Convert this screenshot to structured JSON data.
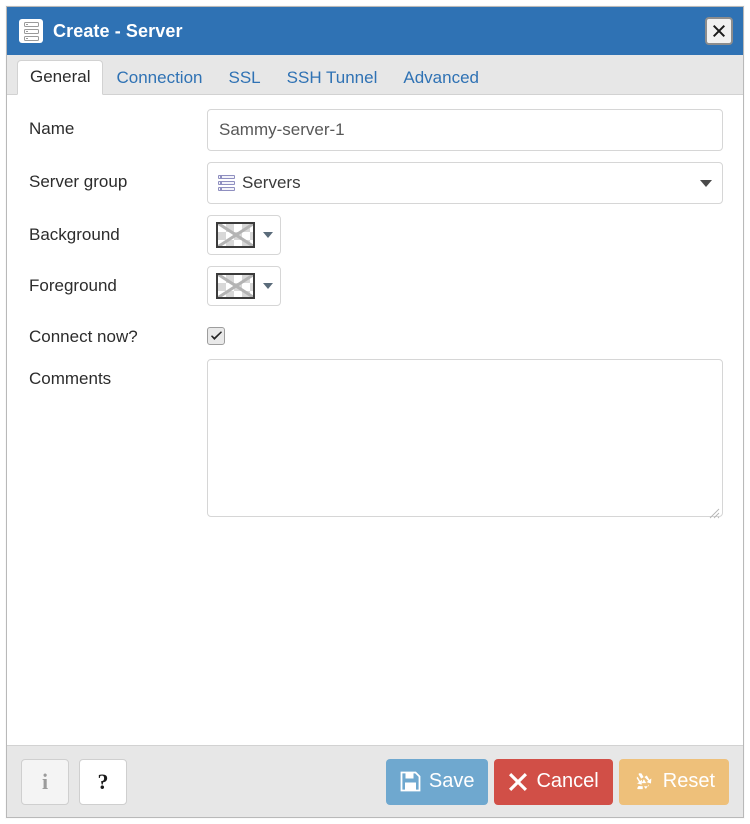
{
  "window": {
    "title": "Create - Server",
    "title_icon": "server-icon",
    "close_icon": "close-icon",
    "titlebar_color": "#2f72b4"
  },
  "tabs": [
    {
      "label": "General",
      "active": true
    },
    {
      "label": "Connection",
      "active": false
    },
    {
      "label": "SSL",
      "active": false
    },
    {
      "label": "SSH Tunnel",
      "active": false
    },
    {
      "label": "Advanced",
      "active": false
    }
  ],
  "form": {
    "name": {
      "label": "Name",
      "value": "Sammy-server-1",
      "placeholder": "Name"
    },
    "server_group": {
      "label": "Server group",
      "value": "Servers",
      "icon": "server-group-icon",
      "caret_icon": "chevron-down-icon"
    },
    "background": {
      "label": "Background",
      "value": "",
      "swatch": "transparent-none",
      "caret_icon": "chevron-down-icon"
    },
    "foreground": {
      "label": "Foreground",
      "value": "",
      "swatch": "transparent-none",
      "caret_icon": "chevron-down-icon"
    },
    "connect_now": {
      "label": "Connect now?",
      "checked": true,
      "check_icon": "checkmark-icon"
    },
    "comments": {
      "label": "Comments",
      "value": "",
      "placeholder": ""
    }
  },
  "footer": {
    "info_label": "i",
    "info_icon": "info-icon",
    "help_label": "?",
    "help_icon": "help-icon",
    "save_label": "Save",
    "save_icon": "floppy-disk-icon",
    "save_color": "#6fa8cf",
    "cancel_label": "Cancel",
    "cancel_icon": "x-icon",
    "cancel_color": "#d14f47",
    "reset_label": "Reset",
    "reset_icon": "recycle-icon",
    "reset_color": "#eec07a"
  }
}
